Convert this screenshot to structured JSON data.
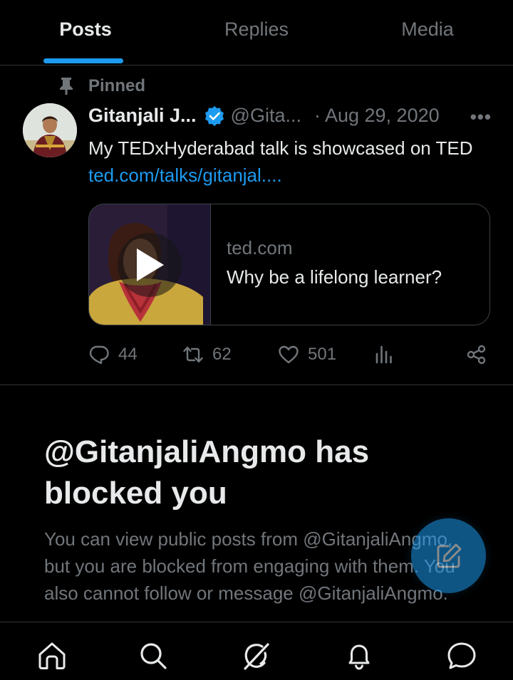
{
  "tabs": [
    {
      "label": "Posts",
      "active": true
    },
    {
      "label": "Replies",
      "active": false
    },
    {
      "label": "Media",
      "active": false
    }
  ],
  "post": {
    "pinned_label": "Pinned",
    "author_name": "Gitanjali J...",
    "author_handle": "@Gita...",
    "separator": "·",
    "date": "Aug 29, 2020",
    "more": "•••",
    "text_prefix": "My TEDxHyderabad talk is showcased on TED ",
    "link_text": "ted.com/talks/gitanjal....",
    "card": {
      "domain": "ted.com",
      "title": "Why be a lifelong learner?"
    },
    "stats": {
      "replies": "44",
      "reposts": "62",
      "likes": "501"
    }
  },
  "blocked": {
    "title": "@GitanjaliAngmo has blocked you",
    "description": "You can view public posts from @GitanjaliAngmo, but you are blocked from engaging with them. You also cannot follow or message @GitanjaliAngmo."
  },
  "colors": {
    "accent": "#1d9bf0",
    "muted": "#71767b",
    "text": "#e7e9ea",
    "border": "#2f3336",
    "background": "#000000"
  },
  "icons": {
    "pin": "pin-icon",
    "verified": "verified-badge-icon",
    "reply": "reply-icon",
    "repost": "repost-icon",
    "like": "heart-icon",
    "views": "analytics-icon",
    "share": "share-icon",
    "compose": "compose-icon",
    "home": "home-icon",
    "search": "search-icon",
    "grok": "grok-icon",
    "notifications": "bell-icon",
    "messages": "chat-icon"
  }
}
